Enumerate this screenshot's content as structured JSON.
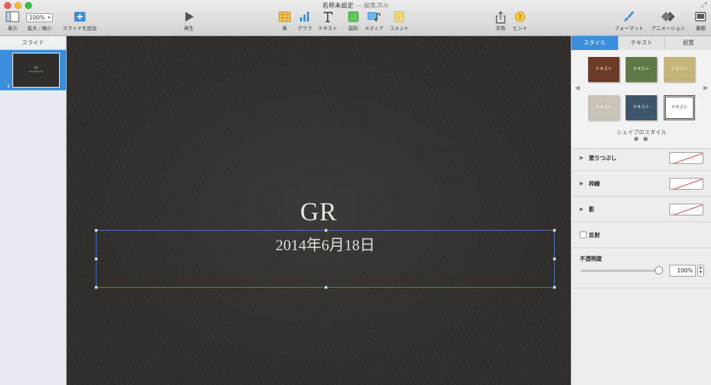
{
  "window": {
    "title": "名称未設定",
    "title_suffix": " — 編集済み"
  },
  "toolbar": {
    "view_label": "表示",
    "zoom_value": "100%",
    "zoom_label": "拡大／縮小",
    "add_slide_label": "スライドを追加",
    "play_label": "再生",
    "table_label": "表",
    "chart_label": "グラフ",
    "text_label": "テキスト",
    "shape_label": "図形",
    "media_label": "メディア",
    "comment_label": "コメント",
    "share_label": "共有",
    "tips_label": "ヒント",
    "format_label": "フォーマット",
    "animate_label": "アニメーション",
    "document_label": "書類"
  },
  "slide_panel": {
    "header": "スライド",
    "slides": [
      {
        "number": "1",
        "title": "GR",
        "subtitle": "2014年6月18日"
      }
    ]
  },
  "canvas": {
    "title": "GR",
    "subtitle": "2014年6月18日"
  },
  "inspector": {
    "tabs": [
      {
        "label": "スタイル",
        "active": true
      },
      {
        "label": "テキスト",
        "active": false
      },
      {
        "label": "配置",
        "active": false
      }
    ],
    "style_swatches": [
      {
        "label": "テキスト",
        "color": "#6b3b25"
      },
      {
        "label": "テキスト",
        "color": "#5e7a45"
      },
      {
        "label": "テキスト",
        "color": "#c3b578"
      },
      {
        "label": "テキスト",
        "color": "#c8c3b6"
      },
      {
        "label": "テキスト",
        "color": "#3f5569"
      },
      {
        "label": "テキスト",
        "color": "#ffffff"
      }
    ],
    "styles_caption": "シェイプのスタイル",
    "fill_label": "塗りつぶし",
    "border_label": "枠線",
    "shadow_label": "影",
    "reflection_label": "反射",
    "opacity_label": "不透明度",
    "opacity_value": "100%",
    "opacity_level": 1.0
  },
  "colors": {
    "accent": "#3b8fdc",
    "canvas_bg": "#2e2d2a"
  }
}
